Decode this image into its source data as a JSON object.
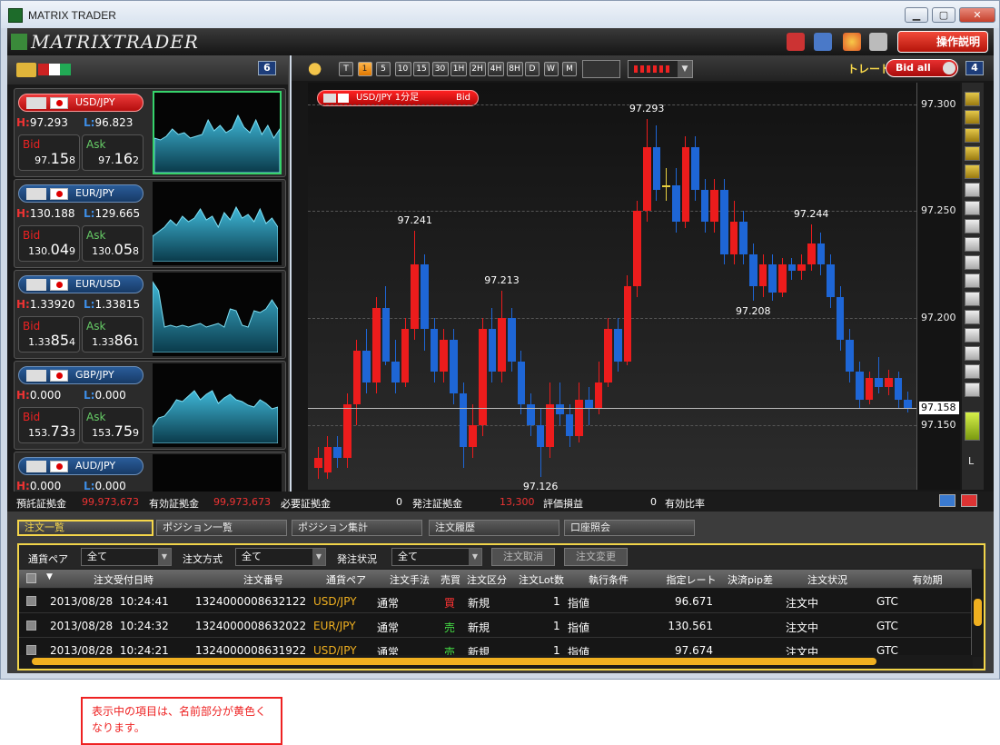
{
  "window": {
    "title": "MATRIX TRADER",
    "min": "▁",
    "max": "▢",
    "close": "✕"
  },
  "app": {
    "logo": "MATRIXTRADER",
    "help_label": "操作説明"
  },
  "left_panel": {
    "count": "6"
  },
  "pairs": [
    {
      "name": "USD/JPY",
      "high": "97.293",
      "low": "96.823",
      "bid_pre": "97.",
      "bid_main": "15",
      "bid_post": "8",
      "ask_pre": "97.",
      "ask_main": "16",
      "ask_post": "2",
      "active": true
    },
    {
      "name": "EUR/JPY",
      "high": "130.188",
      "low": "129.665",
      "bid_pre": "130.",
      "bid_main": "04",
      "bid_post": "9",
      "ask_pre": "130.",
      "ask_main": "05",
      "ask_post": "8",
      "active": false
    },
    {
      "name": "EUR/USD",
      "high": "1.33920",
      "low": "1.33815",
      "bid_pre": "1.33",
      "bid_main": "85",
      "bid_post": "4",
      "ask_pre": "1.33",
      "ask_main": "86",
      "ask_post": "1",
      "active": false
    },
    {
      "name": "GBP/JPY",
      "high": "0.000",
      "low": "0.000",
      "bid_pre": "153.",
      "bid_main": "73",
      "bid_post": "3",
      "ask_pre": "153.",
      "ask_main": "75",
      "ask_post": "9",
      "active": false
    },
    {
      "name": "AUD/JPY",
      "high": "0.000",
      "low": "0.000",
      "bid_pre": "",
      "bid_main": "",
      "bid_post": "",
      "ask_pre": "",
      "ask_main": "",
      "ask_post": "",
      "active": false
    }
  ],
  "labels": {
    "bid": "Bid",
    "ask": "Ask",
    "h": "H:",
    "l": "L:"
  },
  "chart_toolbar": {
    "timeframes": [
      "T",
      "1",
      "5",
      "10",
      "15",
      "30",
      "1H",
      "2H",
      "4H",
      "8H",
      "D",
      "W",
      "M"
    ],
    "active_timeframe": "1",
    "trade_label": "トレード",
    "bid_all": "Bid all",
    "panel_count": "4"
  },
  "chart": {
    "symbol_label": "USD/JPY 1分足",
    "side": "Bid",
    "current_price": "97.158",
    "annotations": [
      "97.293",
      "97.241",
      "97.213",
      "97.244",
      "97.208",
      "97.126"
    ],
    "scale_letter": "L"
  },
  "chart_data": {
    "type": "candlestick",
    "y_ticks": [
      97.3,
      97.25,
      97.2,
      97.15
    ],
    "ylim": [
      97.12,
      97.31
    ],
    "candles": [
      {
        "o": 97.13,
        "c": 97.135,
        "h": 97.14,
        "l": 97.125
      },
      {
        "o": 97.128,
        "c": 97.14,
        "h": 97.145,
        "l": 97.125
      },
      {
        "o": 97.14,
        "c": 97.135,
        "h": 97.145,
        "l": 97.13
      },
      {
        "o": 97.135,
        "c": 97.16,
        "h": 97.165,
        "l": 97.13
      },
      {
        "o": 97.16,
        "c": 97.185,
        "h": 97.19,
        "l": 97.15
      },
      {
        "o": 97.185,
        "c": 97.17,
        "h": 97.195,
        "l": 97.165
      },
      {
        "o": 97.17,
        "c": 97.205,
        "h": 97.21,
        "l": 97.165
      },
      {
        "o": 97.205,
        "c": 97.18,
        "h": 97.215,
        "l": 97.178
      },
      {
        "o": 97.18,
        "c": 97.17,
        "h": 97.19,
        "l": 97.165
      },
      {
        "o": 97.17,
        "c": 97.195,
        "h": 97.2,
        "l": 97.168
      },
      {
        "o": 97.195,
        "c": 97.225,
        "h": 97.241,
        "l": 97.19
      },
      {
        "o": 97.225,
        "c": 97.195,
        "h": 97.23,
        "l": 97.185
      },
      {
        "o": 97.195,
        "c": 97.175,
        "h": 97.2,
        "l": 97.17
      },
      {
        "o": 97.175,
        "c": 97.19,
        "h": 97.195,
        "l": 97.17
      },
      {
        "o": 97.19,
        "c": 97.165,
        "h": 97.195,
        "l": 97.16
      },
      {
        "o": 97.165,
        "c": 97.14,
        "h": 97.17,
        "l": 97.13
      },
      {
        "o": 97.14,
        "c": 97.15,
        "h": 97.16,
        "l": 97.135
      },
      {
        "o": 97.15,
        "c": 97.195,
        "h": 97.2,
        "l": 97.145
      },
      {
        "o": 97.195,
        "c": 97.175,
        "h": 97.205,
        "l": 97.17
      },
      {
        "o": 97.175,
        "c": 97.2,
        "h": 97.213,
        "l": 97.17
      },
      {
        "o": 97.2,
        "c": 97.18,
        "h": 97.205,
        "l": 97.175
      },
      {
        "o": 97.18,
        "c": 97.16,
        "h": 97.185,
        "l": 97.155
      },
      {
        "o": 97.16,
        "c": 97.15,
        "h": 97.165,
        "l": 97.145
      },
      {
        "o": 97.15,
        "c": 97.14,
        "h": 97.158,
        "l": 97.126
      },
      {
        "o": 97.14,
        "c": 97.16,
        "h": 97.17,
        "l": 97.135
      },
      {
        "o": 97.16,
        "c": 97.155,
        "h": 97.17,
        "l": 97.15
      },
      {
        "o": 97.155,
        "c": 97.145,
        "h": 97.16,
        "l": 97.14
      },
      {
        "o": 97.145,
        "c": 97.162,
        "h": 97.17,
        "l": 97.142
      },
      {
        "o": 97.162,
        "c": 97.158,
        "h": 97.168,
        "l": 97.15
      },
      {
        "o": 97.158,
        "c": 97.17,
        "h": 97.18,
        "l": 97.155
      },
      {
        "o": 97.17,
        "c": 97.195,
        "h": 97.2,
        "l": 97.168
      },
      {
        "o": 97.195,
        "c": 97.18,
        "h": 97.2,
        "l": 97.175
      },
      {
        "o": 97.18,
        "c": 97.215,
        "h": 97.22,
        "l": 97.178
      },
      {
        "o": 97.215,
        "c": 97.25,
        "h": 97.255,
        "l": 97.21
      },
      {
        "o": 97.25,
        "c": 97.28,
        "h": 97.293,
        "l": 97.245
      },
      {
        "o": 97.28,
        "c": 97.26,
        "h": 97.29,
        "l": 97.255
      },
      {
        "o": 97.262,
        "c": 97.262,
        "h": 97.27,
        "l": 97.255
      },
      {
        "o": 97.262,
        "c": 97.245,
        "h": 97.27,
        "l": 97.24
      },
      {
        "o": 97.245,
        "c": 97.28,
        "h": 97.285,
        "l": 97.242
      },
      {
        "o": 97.28,
        "c": 97.26,
        "h": 97.285,
        "l": 97.255
      },
      {
        "o": 97.26,
        "c": 97.245,
        "h": 97.265,
        "l": 97.24
      },
      {
        "o": 97.245,
        "c": 97.26,
        "h": 97.265,
        "l": 97.24
      },
      {
        "o": 97.26,
        "c": 97.23,
        "h": 97.265,
        "l": 97.225
      },
      {
        "o": 97.23,
        "c": 97.245,
        "h": 97.255,
        "l": 97.225
      },
      {
        "o": 97.245,
        "c": 97.23,
        "h": 97.25,
        "l": 97.225
      },
      {
        "o": 97.23,
        "c": 97.215,
        "h": 97.235,
        "l": 97.208
      },
      {
        "o": 97.215,
        "c": 97.225,
        "h": 97.23,
        "l": 97.21
      },
      {
        "o": 97.225,
        "c": 97.212,
        "h": 97.23,
        "l": 97.208
      },
      {
        "o": 97.212,
        "c": 97.225,
        "h": 97.228,
        "l": 97.21
      },
      {
        "o": 97.225,
        "c": 97.222,
        "h": 97.228,
        "l": 97.218
      },
      {
        "o": 97.222,
        "c": 97.225,
        "h": 97.23,
        "l": 97.218
      },
      {
        "o": 97.225,
        "c": 97.235,
        "h": 97.244,
        "l": 97.222
      },
      {
        "o": 97.235,
        "c": 97.225,
        "h": 97.24,
        "l": 97.22
      },
      {
        "o": 97.225,
        "c": 97.21,
        "h": 97.23,
        "l": 97.205
      },
      {
        "o": 97.21,
        "c": 97.19,
        "h": 97.215,
        "l": 97.185
      },
      {
        "o": 97.19,
        "c": 97.175,
        "h": 97.195,
        "l": 97.17
      },
      {
        "o": 97.175,
        "c": 97.162,
        "h": 97.18,
        "l": 97.158
      },
      {
        "o": 97.162,
        "c": 97.172,
        "h": 97.175,
        "l": 97.16
      },
      {
        "o": 97.172,
        "c": 97.168,
        "h": 97.182,
        "l": 97.165
      },
      {
        "o": 97.168,
        "c": 97.172,
        "h": 97.176,
        "l": 97.164
      },
      {
        "o": 97.172,
        "c": 97.162,
        "h": 97.175,
        "l": 97.158
      },
      {
        "o": 97.162,
        "c": 97.158,
        "h": 97.166,
        "l": 97.156
      }
    ]
  },
  "account": {
    "deposit_label": "預託証拠金",
    "deposit": "99,973,673",
    "effective_label": "有効証拠金",
    "effective": "99,973,673",
    "required_label": "必要証拠金",
    "required": "0",
    "order_margin_label": "発注証拠金",
    "order_margin": "13,300",
    "pnl_label": "評価損益",
    "pnl": "0",
    "ratio_label": "有効比率"
  },
  "tabs": [
    "注文一覧",
    "ポジション一覧",
    "ポジション集計",
    "注文履歴",
    "口座照会"
  ],
  "filters": {
    "pair_label": "通貨ペア",
    "pair_value": "全て",
    "method_label": "注文方式",
    "method_value": "全て",
    "status_label": "発注状況",
    "status_value": "全て",
    "cancel_label": "注文取消",
    "change_label": "注文変更"
  },
  "table": {
    "headers": [
      "注文受付日時",
      "注文番号",
      "通貨ペア",
      "注文手法",
      "売買",
      "注文区分",
      "注文Lot数",
      "執行条件",
      "指定レート",
      "決済pip差",
      "注文状況",
      "有効期"
    ],
    "rows": [
      {
        "date": "2013/08/28",
        "time": "10:24:41",
        "no": "1324000008632122",
        "pair": "USD/JPY",
        "method": "通常",
        "side": "買",
        "kind": "新規",
        "lot": "1",
        "cond": "指値",
        "rate": "96.671",
        "pip": "",
        "status": "注文中",
        "exp": "GTC"
      },
      {
        "date": "2013/08/28",
        "time": "10:24:32",
        "no": "1324000008632022",
        "pair": "EUR/JPY",
        "method": "通常",
        "side": "売",
        "kind": "新規",
        "lot": "1",
        "cond": "指値",
        "rate": "130.561",
        "pip": "",
        "status": "注文中",
        "exp": "GTC"
      },
      {
        "date": "2013/08/28",
        "time": "10:24:21",
        "no": "1324000008631922",
        "pair": "USD/JPY",
        "method": "通常",
        "side": "売",
        "kind": "新規",
        "lot": "1",
        "cond": "指値",
        "rate": "97.674",
        "pip": "",
        "status": "注文中",
        "exp": "GTC"
      }
    ]
  },
  "note": {
    "text": "表示中の項目は、名前部分が黄色くなります。"
  },
  "colors": {
    "accent_red": "#e82020",
    "accent_yellow": "#f5d64a",
    "bid_red": "#e22",
    "ask_green": "#6c6",
    "candle_up": "#ec1c1c",
    "candle_down": "#1e66d6"
  }
}
